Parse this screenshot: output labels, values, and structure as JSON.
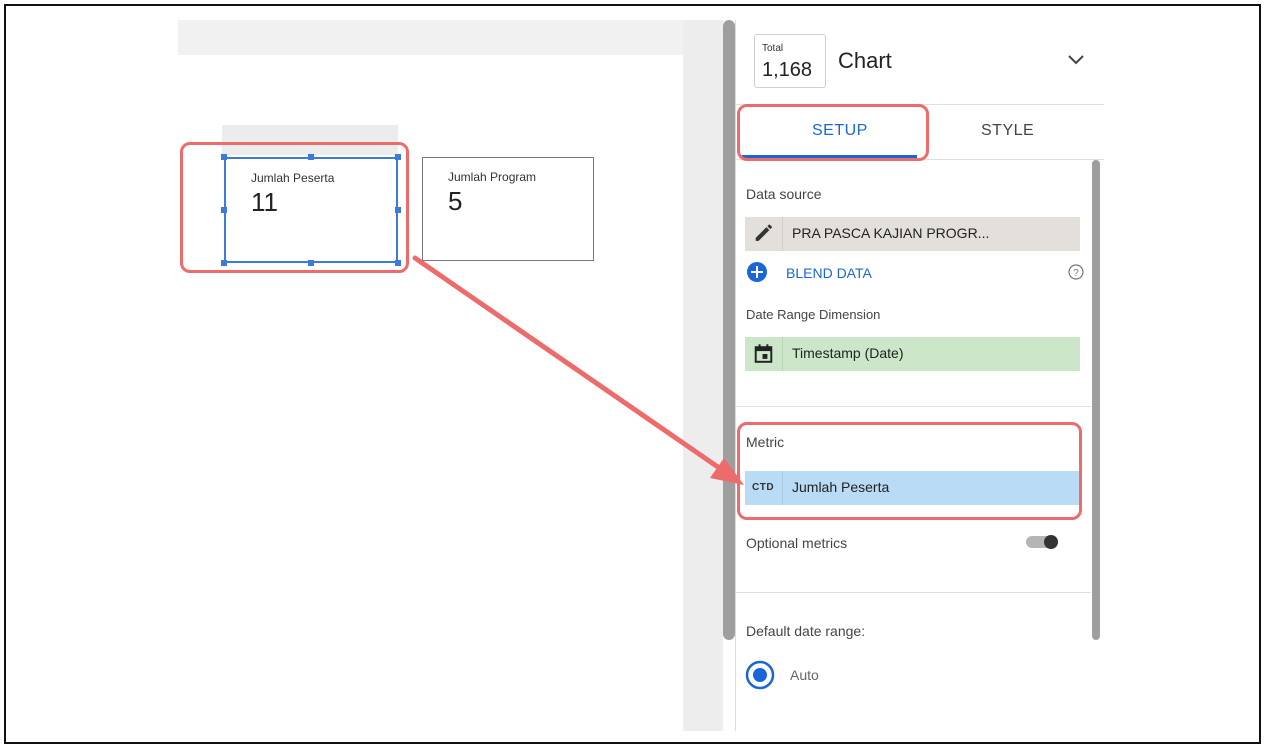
{
  "scorecards": [
    {
      "label": "Jumlah Peserta",
      "value": "11"
    },
    {
      "label": "Jumlah Program",
      "value": "5"
    }
  ],
  "panel": {
    "total_label": "Total",
    "total_value": "1,168",
    "title": "Chart",
    "tabs": {
      "setup": "SETUP",
      "style": "STYLE"
    },
    "data_source_label": "Data source",
    "data_source_value": "PRA PASCA KAJIAN PROGR...",
    "blend_label": "BLEND DATA",
    "date_range_dimension_label": "Date Range Dimension",
    "date_range_dimension_value": "Timestamp (Date)",
    "metric_label": "Metric",
    "metric_type": "CTD",
    "metric_value": "Jumlah Peserta",
    "optional_metrics_label": "Optional metrics",
    "default_date_range_label": "Default date range:",
    "radio_auto_label": "Auto"
  },
  "colors": {
    "accent": "#1a66d6",
    "highlight": "#ee6b6b",
    "selection": "#3d7bd9",
    "data_source_chip": "#e3dfdb",
    "dimension_chip": "#cbe6c8",
    "metric_chip": "#b9dbf5"
  }
}
